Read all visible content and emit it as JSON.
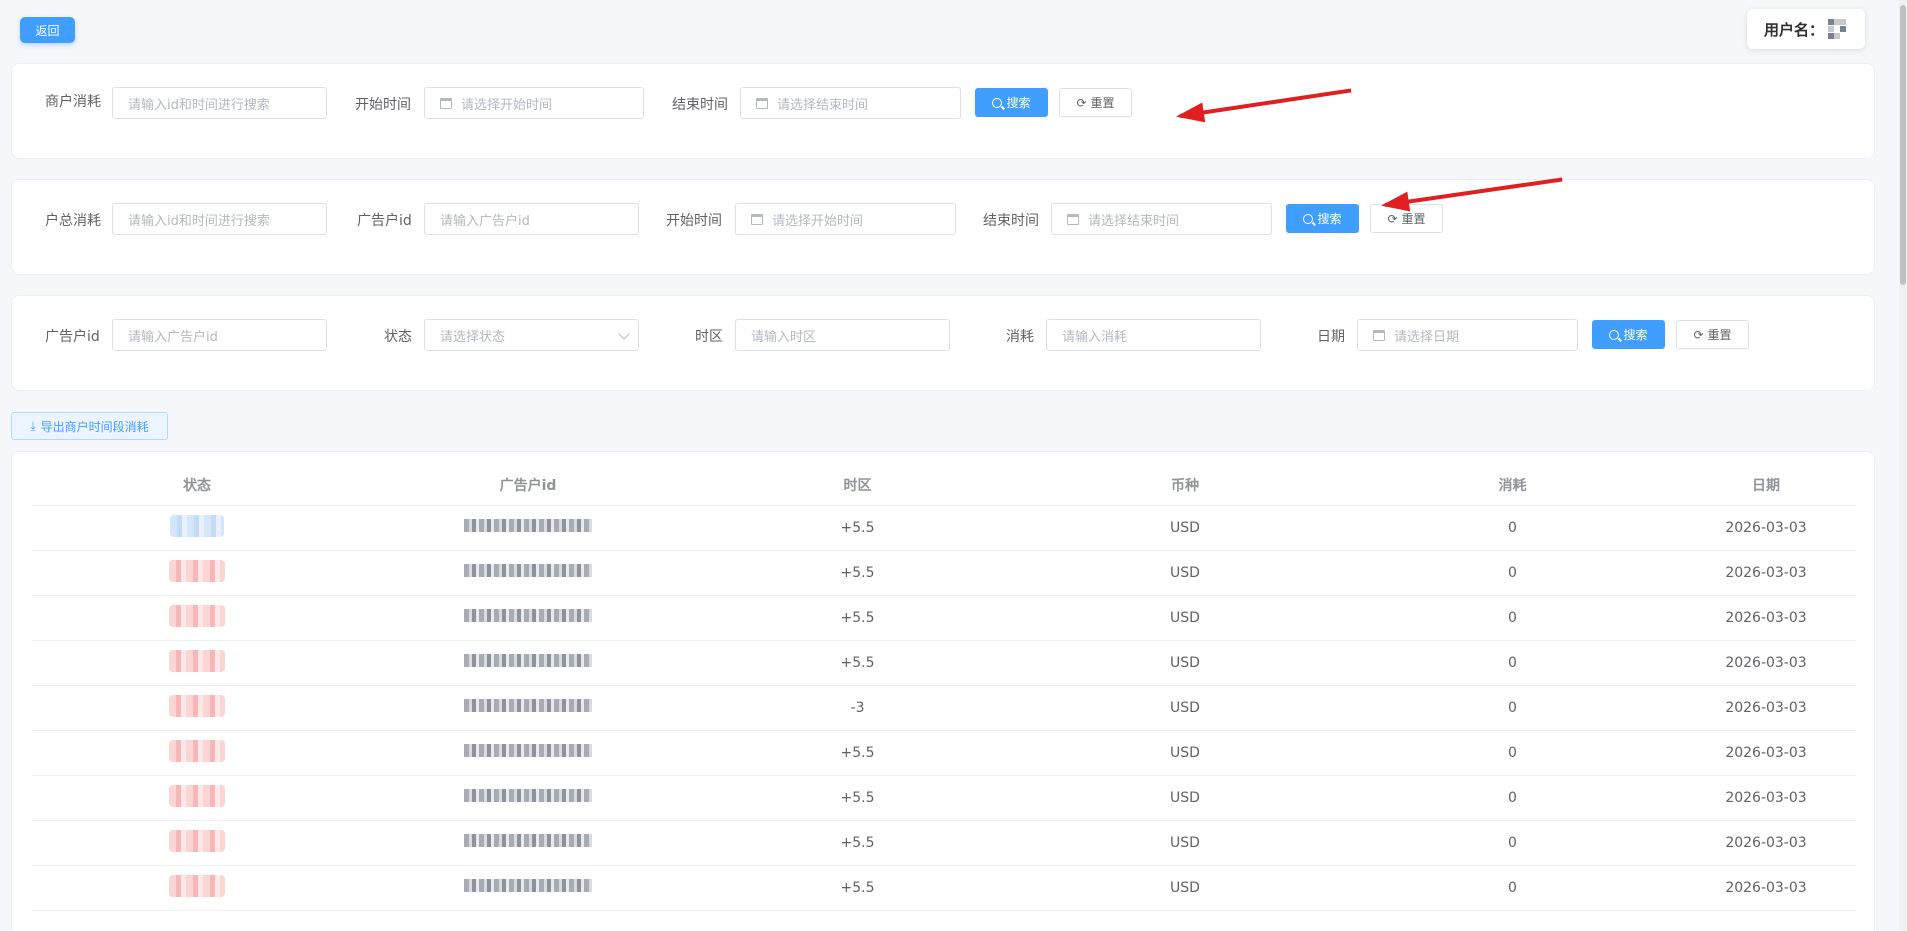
{
  "header": {
    "back_label": "返回",
    "username_label": "用户名："
  },
  "merchant_filter": {
    "label": "商户消耗",
    "keyword_placeholder": "请输入id和时间进行搜索",
    "start_label": "开始时间",
    "start_placeholder": "请选择开始时间",
    "end_label": "结束时间",
    "end_placeholder": "请选择结束时间",
    "search_label": "搜索",
    "reset_label": "重置"
  },
  "account_filter": {
    "label": "户总消耗",
    "keyword_placeholder": "请输入id和时间进行搜索",
    "adid_label": "广告户id",
    "adid_placeholder": "请输入广告户id",
    "start_label": "开始时间",
    "start_placeholder": "请选择开始时间",
    "end_label": "结束时间",
    "end_placeholder": "请选择结束时间",
    "search_label": "搜索",
    "reset_label": "重置"
  },
  "detail_filter": {
    "adid_label": "广告户id",
    "adid_placeholder": "请输入广告户id",
    "status_label": "状态",
    "status_placeholder": "请选择状态",
    "tz_label": "时区",
    "tz_placeholder": "请输入时区",
    "spend_label": "消耗",
    "spend_placeholder": "请输入消耗",
    "date_label": "日期",
    "date_placeholder": "请选择日期",
    "search_label": "搜索",
    "reset_label": "重置"
  },
  "export_label": "导出商户时间段消耗",
  "table": {
    "columns": [
      "状态",
      "广告户id",
      "时区",
      "币种",
      "消耗",
      "日期"
    ],
    "rows": [
      {
        "tz": "+5.5",
        "currency": "USD",
        "spend": "0",
        "date": "2026-03-03"
      },
      {
        "tz": "+5.5",
        "currency": "USD",
        "spend": "0",
        "date": "2026-03-03"
      },
      {
        "tz": "+5.5",
        "currency": "USD",
        "spend": "0",
        "date": "2026-03-03"
      },
      {
        "tz": "+5.5",
        "currency": "USD",
        "spend": "0",
        "date": "2026-03-03"
      },
      {
        "tz": "-3",
        "currency": "USD",
        "spend": "0",
        "date": "2026-03-03"
      },
      {
        "tz": "+5.5",
        "currency": "USD",
        "spend": "0",
        "date": "2026-03-03"
      },
      {
        "tz": "+5.5",
        "currency": "USD",
        "spend": "0",
        "date": "2026-03-03"
      },
      {
        "tz": "+5.5",
        "currency": "USD",
        "spend": "0",
        "date": "2026-03-03"
      },
      {
        "tz": "+5.5",
        "currency": "USD",
        "spend": "0",
        "date": "2026-03-03"
      }
    ]
  },
  "colors": {
    "primary": "#409eff",
    "annotation_arrow": "#e02020"
  }
}
